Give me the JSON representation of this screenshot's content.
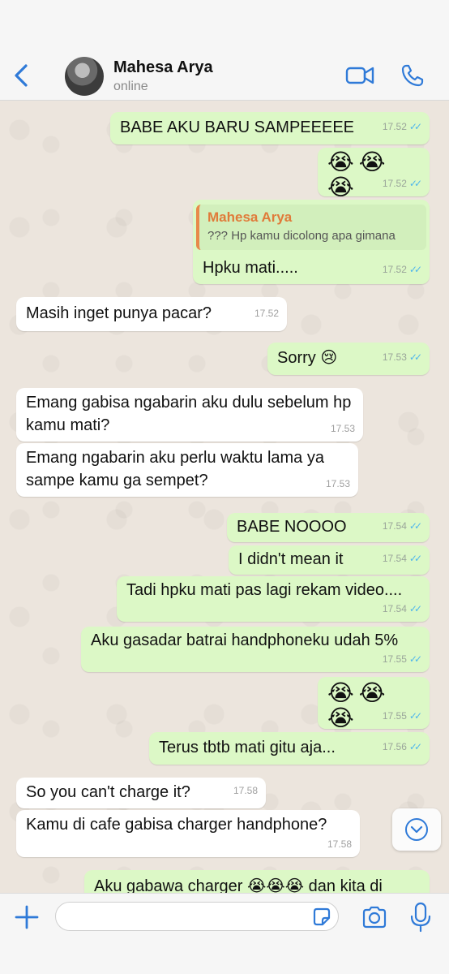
{
  "header": {
    "contact_name": "Mahesa Arya",
    "status": "online"
  },
  "messages": [
    {
      "dir": "out",
      "text": "BABE AKU BARU SAMPEEEEE",
      "time": "17.52",
      "ticks": "✓✓"
    },
    {
      "dir": "out",
      "text": "😭😭😭",
      "time": "17.52",
      "ticks": "✓✓"
    },
    {
      "dir": "out",
      "reply_name": "Mahesa Arya",
      "reply_text": "??? Hp kamu dicolong apa gimana",
      "text": "Hpku mati.....",
      "time": "17.52",
      "ticks": "✓✓"
    },
    {
      "dir": "in",
      "text": "Masih inget punya pacar?",
      "time": "17.52"
    },
    {
      "dir": "out",
      "text": "Sorry 😢",
      "time": "17.53",
      "ticks": "✓✓"
    },
    {
      "dir": "in",
      "text": "Emang gabisa ngabarin aku dulu sebelum hp kamu mati?",
      "time": "17.53"
    },
    {
      "dir": "in",
      "text": "Emang ngabarin aku perlu waktu lama ya sampe kamu ga sempet?",
      "time": "17.53"
    },
    {
      "dir": "out",
      "text": "BABE NOOOO",
      "time": "17.54",
      "ticks": "✓✓"
    },
    {
      "dir": "out",
      "text": "I didn't mean it",
      "time": "17.54",
      "ticks": "✓✓"
    },
    {
      "dir": "out",
      "text": "Tadi hpku mati pas lagi rekam video....",
      "time": "17.54",
      "ticks": "✓✓"
    },
    {
      "dir": "out",
      "text": "Aku gasadar batrai handphoneku udah 5%",
      "time": "17.55",
      "ticks": "✓✓"
    },
    {
      "dir": "out",
      "text": "😭😭😭",
      "time": "17.55",
      "ticks": "✓✓"
    },
    {
      "dir": "out",
      "text": "Terus tbtb mati gitu aja...",
      "time": "17.56",
      "ticks": "✓✓"
    },
    {
      "dir": "in",
      "text": "So you can't charge it?",
      "time": "17.58"
    },
    {
      "dir": "in",
      "text": "Kamu di cafe gabisa charger handphone?",
      "time": "17.58"
    },
    {
      "dir": "out",
      "text": "Aku gabawa charger 😭😭😭 dan kita di"
    }
  ],
  "input": {
    "placeholder": ""
  },
  "colors": {
    "accent": "#2f7ad8",
    "outgoing_bubble": "#dcf8c6",
    "incoming_bubble": "#ffffff",
    "read_ticks": "#4fb6ec",
    "reply_name": "#e07b3a"
  }
}
